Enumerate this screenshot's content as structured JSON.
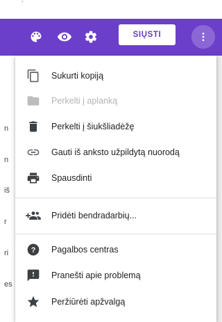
{
  "edge_text": [
    "n",
    "n",
    "iš",
    "r",
    "ri",
    "es"
  ],
  "toolbar": {
    "send_label": "SIŲSTI",
    "icons": [
      "palette-icon",
      "eye-icon",
      "gear-icon",
      "more-vert-icon"
    ],
    "color": "#6b3fc9"
  },
  "menu": {
    "items": [
      {
        "label": "Sukurti kopiją",
        "icon": "copy-icon",
        "enabled": true
      },
      {
        "label": "Perkelti į aplanką",
        "icon": "folder-icon",
        "enabled": false
      },
      {
        "label": "Perkelti į šiukšliadėžę",
        "icon": "trash-icon",
        "enabled": true
      },
      {
        "label": "Gauti iš anksto užpildytą nuorodą",
        "icon": "link-icon",
        "enabled": true
      },
      {
        "label": "Spausdinti",
        "icon": "print-icon",
        "enabled": true
      },
      {
        "label": "Pridėti bendradarbių...",
        "icon": "add-people-icon",
        "enabled": true
      },
      {
        "label": "Pagalbos centras",
        "icon": "help-icon",
        "enabled": true
      },
      {
        "label": "Pranešti apie problemą",
        "icon": "feedback-icon",
        "enabled": true
      },
      {
        "label": "Peržiūrėti apžvalgą",
        "icon": "star-icon",
        "enabled": true
      }
    ]
  }
}
